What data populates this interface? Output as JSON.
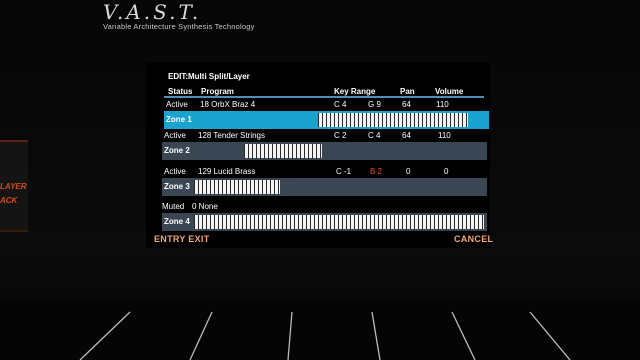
{
  "brand": {
    "logo_text": "V.A.S.T.",
    "tagline": "Variable Architecture Synthesis Technology"
  },
  "side_panel": {
    "line1": "LAYER",
    "line2": "ACK"
  },
  "screen": {
    "title": "EDIT:Multi Split/Layer",
    "columns": {
      "status": "Status",
      "program": "Program",
      "key_range": "Key Range",
      "pan": "Pan",
      "volume": "Volume"
    },
    "zones": [
      {
        "status": "Active",
        "program": "18 OrbX Braz 4",
        "key_low": "C 4",
        "key_high": "G 9",
        "pan": "64",
        "volume": "110",
        "label": "Zone 1",
        "selected": true,
        "key_high_warn": false
      },
      {
        "status": "Active",
        "program": "128 Tender Strings",
        "key_low": "C 2",
        "key_high": "C 4",
        "pan": "64",
        "volume": "110",
        "label": "Zone 2",
        "selected": false,
        "key_high_warn": false
      },
      {
        "status": "Active",
        "program": "129 Lucid Brass",
        "key_low": "C -1",
        "key_high": "B 2",
        "pan": "0",
        "volume": "0",
        "label": "Zone 3",
        "selected": false,
        "key_high_warn": true
      },
      {
        "status": "Muted",
        "program": "0 None",
        "key_low": "",
        "key_high": "",
        "pan": "",
        "volume": "",
        "label": "Zone 4",
        "selected": false,
        "key_high_warn": false
      }
    ],
    "buttons": {
      "entry_exit": "ENTRY EXIT",
      "cancel": "CANCEL"
    }
  },
  "colors": {
    "accent_blue": "#1aa3cf",
    "warn_red": "#e8512a",
    "button_orange": "#f2a774"
  }
}
